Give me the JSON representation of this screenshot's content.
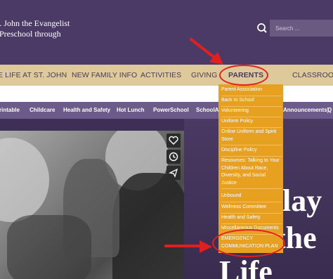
{
  "header": {
    "brand_line1": "t. John the Evangelist",
    "brand_line2": "Preschool through",
    "search_placeholder": "Search ..."
  },
  "main_nav": {
    "items": [
      "E LIFE AT ST. JOHN",
      "NEW FAMILY INFO",
      "ACTIVITIES",
      "GIVING",
      "PARENTS",
      "CLASSROOM"
    ],
    "active": "PARENTS"
  },
  "sub_nav": {
    "items": [
      "rintable",
      "Childcare",
      "Health and Safety",
      "Hot Lunch",
      "PowerSchool",
      "SchoolAd",
      "Announcements)",
      "Q"
    ]
  },
  "dropdown": {
    "items": [
      "Parent Association",
      "Back to School",
      "Volunteering",
      "Uniform Policy",
      "Online Uniform and Spirit Store",
      "Discipline Policy",
      "Resources: Talking to Your Children About Race, Diversity, and Social Justice",
      "Unbound",
      "Wellness Committee",
      "Health and Safety",
      "Miscellaneous Documents",
      "EMERGENCY COMMUNICATION PLAN"
    ]
  },
  "hero": {
    "text_line1": "lay",
    "text_line2": "the",
    "text_line3": "Life"
  },
  "colors": {
    "header_bg": "#4b3a66",
    "nav_bg": "#ddc99a",
    "subnav_bg": "#6b5a8a",
    "dropdown_bg": "#e8a020",
    "annotation_red": "#e02020"
  },
  "icons": [
    "search-icon",
    "heart-icon",
    "clock-icon",
    "send-icon"
  ]
}
